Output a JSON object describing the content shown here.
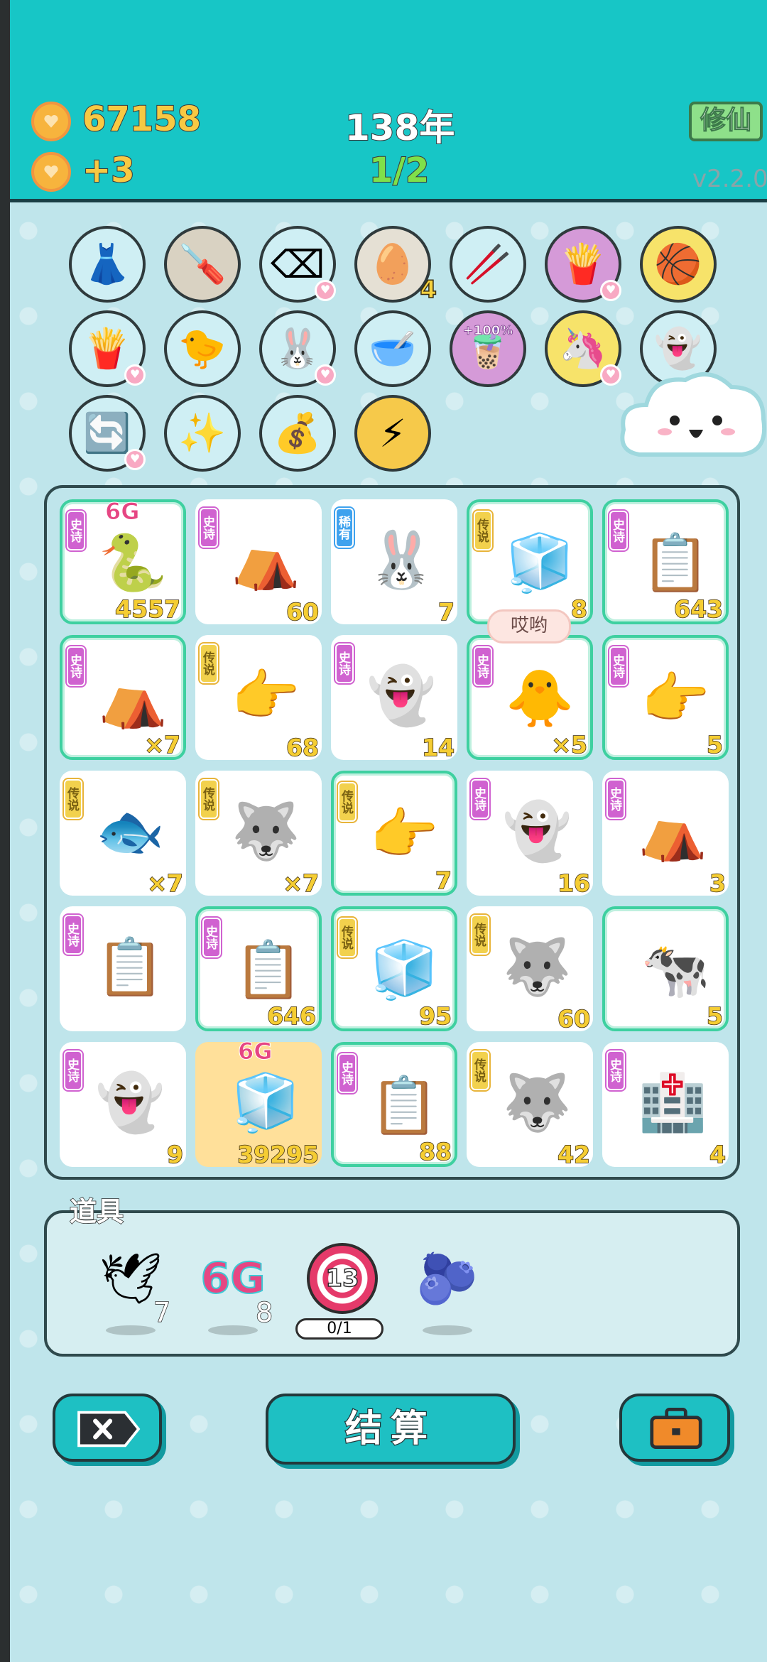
{
  "header": {
    "coins": "67158",
    "income": "+3",
    "year": "138年",
    "round": "1/2",
    "mode_button": "修仙",
    "version": "v2.2.0"
  },
  "skills": [
    {
      "icon": "skirt-icon",
      "glyph": "👗"
    },
    {
      "icon": "screwdriver-icon",
      "glyph": "🪛"
    },
    {
      "icon": "delete-tag-icon",
      "glyph": "⌫",
      "badge": true
    },
    {
      "icon": "egg-tray-icon",
      "glyph": "🥚",
      "count": "4"
    },
    {
      "icon": "chopsticks-icon",
      "glyph": "🥢"
    },
    {
      "icon": "fries-icon",
      "glyph": "🍟",
      "badge": true
    },
    {
      "icon": "basketballs-icon",
      "glyph": "🏀"
    },
    {
      "icon": "fries-icon",
      "glyph": "🍟",
      "badge": true
    },
    {
      "icon": "chick-egg-icon",
      "glyph": "🐤"
    },
    {
      "icon": "rabbit-icon",
      "glyph": "🐰",
      "badge": true
    },
    {
      "icon": "dog-bowl-icon",
      "glyph": "🥣"
    },
    {
      "icon": "milk-tea-icon",
      "glyph": "🧋",
      "label": "+100%"
    },
    {
      "icon": "unicorn-icon",
      "glyph": "🦄",
      "badge": true
    },
    {
      "icon": "ghost-icon",
      "glyph": "👻"
    },
    {
      "icon": "refresh-icon",
      "glyph": "🔄",
      "badge": true
    },
    {
      "icon": "star-wand-icon",
      "glyph": "✨"
    },
    {
      "icon": "sack-icon",
      "glyph": "💰"
    },
    {
      "icon": "lightning-icon",
      "glyph": "⚡"
    }
  ],
  "board": [
    {
      "tag": "史诗",
      "type": "epic",
      "icon": "snake-crown-icon",
      "glyph": "🐍",
      "num": "4557",
      "hl": true,
      "g6": true
    },
    {
      "tag": "史诗",
      "type": "epic",
      "icon": "rabbit-tent-icon",
      "glyph": "⛺",
      "num": "60"
    },
    {
      "tag": "稀有",
      "type": "rare",
      "icon": "rabbit-icon",
      "glyph": "🐰",
      "num": "7"
    },
    {
      "tag": "传说",
      "type": "leg",
      "icon": "fridge-basketball-icon",
      "glyph": "🧊",
      "num": "8",
      "hl": true
    },
    {
      "tag": "史诗",
      "type": "epic",
      "icon": "copy-paste-icon",
      "glyph": "📋",
      "num": "643",
      "hl": true
    },
    {
      "tag": "史诗",
      "type": "epic",
      "icon": "rabbit-tent-icon",
      "glyph": "⛺",
      "num": "×7",
      "hl": true
    },
    {
      "tag": "传说",
      "type": "leg",
      "icon": "pointing-hand-icon",
      "glyph": "👉",
      "num": "68"
    },
    {
      "tag": "史诗",
      "type": "epic",
      "icon": "ghost-basketball-icon",
      "glyph": "👻",
      "num": "14"
    },
    {
      "tag": "史诗",
      "type": "epic",
      "icon": "chick-icon",
      "glyph": "🐥",
      "num": "×5",
      "hl": true
    },
    {
      "tag": "史诗",
      "type": "epic",
      "icon": "grey-hand-icon",
      "glyph": "👉",
      "num": "5",
      "hl": true
    },
    {
      "tag": "传说",
      "type": "leg",
      "icon": "koi-fish-icon",
      "glyph": "🐟",
      "num": "×7"
    },
    {
      "tag": "传说",
      "type": "leg",
      "icon": "husky-crown-icon",
      "glyph": "🐺",
      "num": "×7"
    },
    {
      "tag": "传说",
      "type": "leg",
      "icon": "pointing-hand-icon",
      "glyph": "👉",
      "num": "7",
      "hl": true
    },
    {
      "tag": "史诗",
      "type": "epic",
      "icon": "ghost-icon",
      "glyph": "👻",
      "num": "16"
    },
    {
      "tag": "史诗",
      "type": "epic",
      "icon": "rabbit-tent-icon",
      "glyph": "⛺",
      "num": "3"
    },
    {
      "tag": "史诗",
      "type": "epic",
      "icon": "copy-paste-icon",
      "glyph": "📋",
      "num": ""
    },
    {
      "tag": "史诗",
      "type": "epic",
      "icon": "copy-paste-icon",
      "glyph": "📋",
      "num": "646",
      "hl": true
    },
    {
      "tag": "传说",
      "type": "leg",
      "icon": "fridge-icon",
      "glyph": "🧊",
      "num": "95",
      "hl": true
    },
    {
      "tag": "传说",
      "type": "leg",
      "icon": "husky-basketball-icon",
      "glyph": "🐺",
      "num": "60"
    },
    {
      "tag": "",
      "type": "",
      "icon": "cow-icon",
      "glyph": "🐄",
      "num": "5",
      "hl": true
    },
    {
      "tag": "史诗",
      "type": "epic",
      "icon": "ghost-icon",
      "glyph": "👻",
      "num": "9"
    },
    {
      "tag": "",
      "type": "",
      "icon": "fridge-6g-icon",
      "glyph": "🧊",
      "num": "39295",
      "gold": true,
      "g6": true
    },
    {
      "tag": "史诗",
      "type": "epic",
      "icon": "copy-paste-icon",
      "glyph": "📋",
      "num": "88",
      "hl": true
    },
    {
      "tag": "传说",
      "type": "leg",
      "icon": "husky-crown-icon",
      "glyph": "🐺",
      "num": "42"
    },
    {
      "tag": "史诗",
      "type": "epic",
      "icon": "icu-sign-icon",
      "glyph": "🏥",
      "num": "4"
    }
  ],
  "bubble": "哎哟",
  "props": {
    "label": "道具",
    "items": [
      {
        "icon": "pigeon-icon",
        "glyph": "🕊",
        "count": "7"
      },
      {
        "icon": "6g-icon",
        "glyph": "6G",
        "count": "8"
      },
      {
        "icon": "target-13-icon",
        "glyph": "13",
        "progress": "0/1"
      },
      {
        "icon": "blueberry-icon",
        "glyph": "🫐",
        "count": ""
      }
    ]
  },
  "actions": {
    "settle": "结算"
  },
  "colors": {
    "topbar": "#17c6c6",
    "accent": "#1ec0c3",
    "epic": "#d062d0",
    "legend": "#f2d14d",
    "rare": "#3ea2ee"
  }
}
